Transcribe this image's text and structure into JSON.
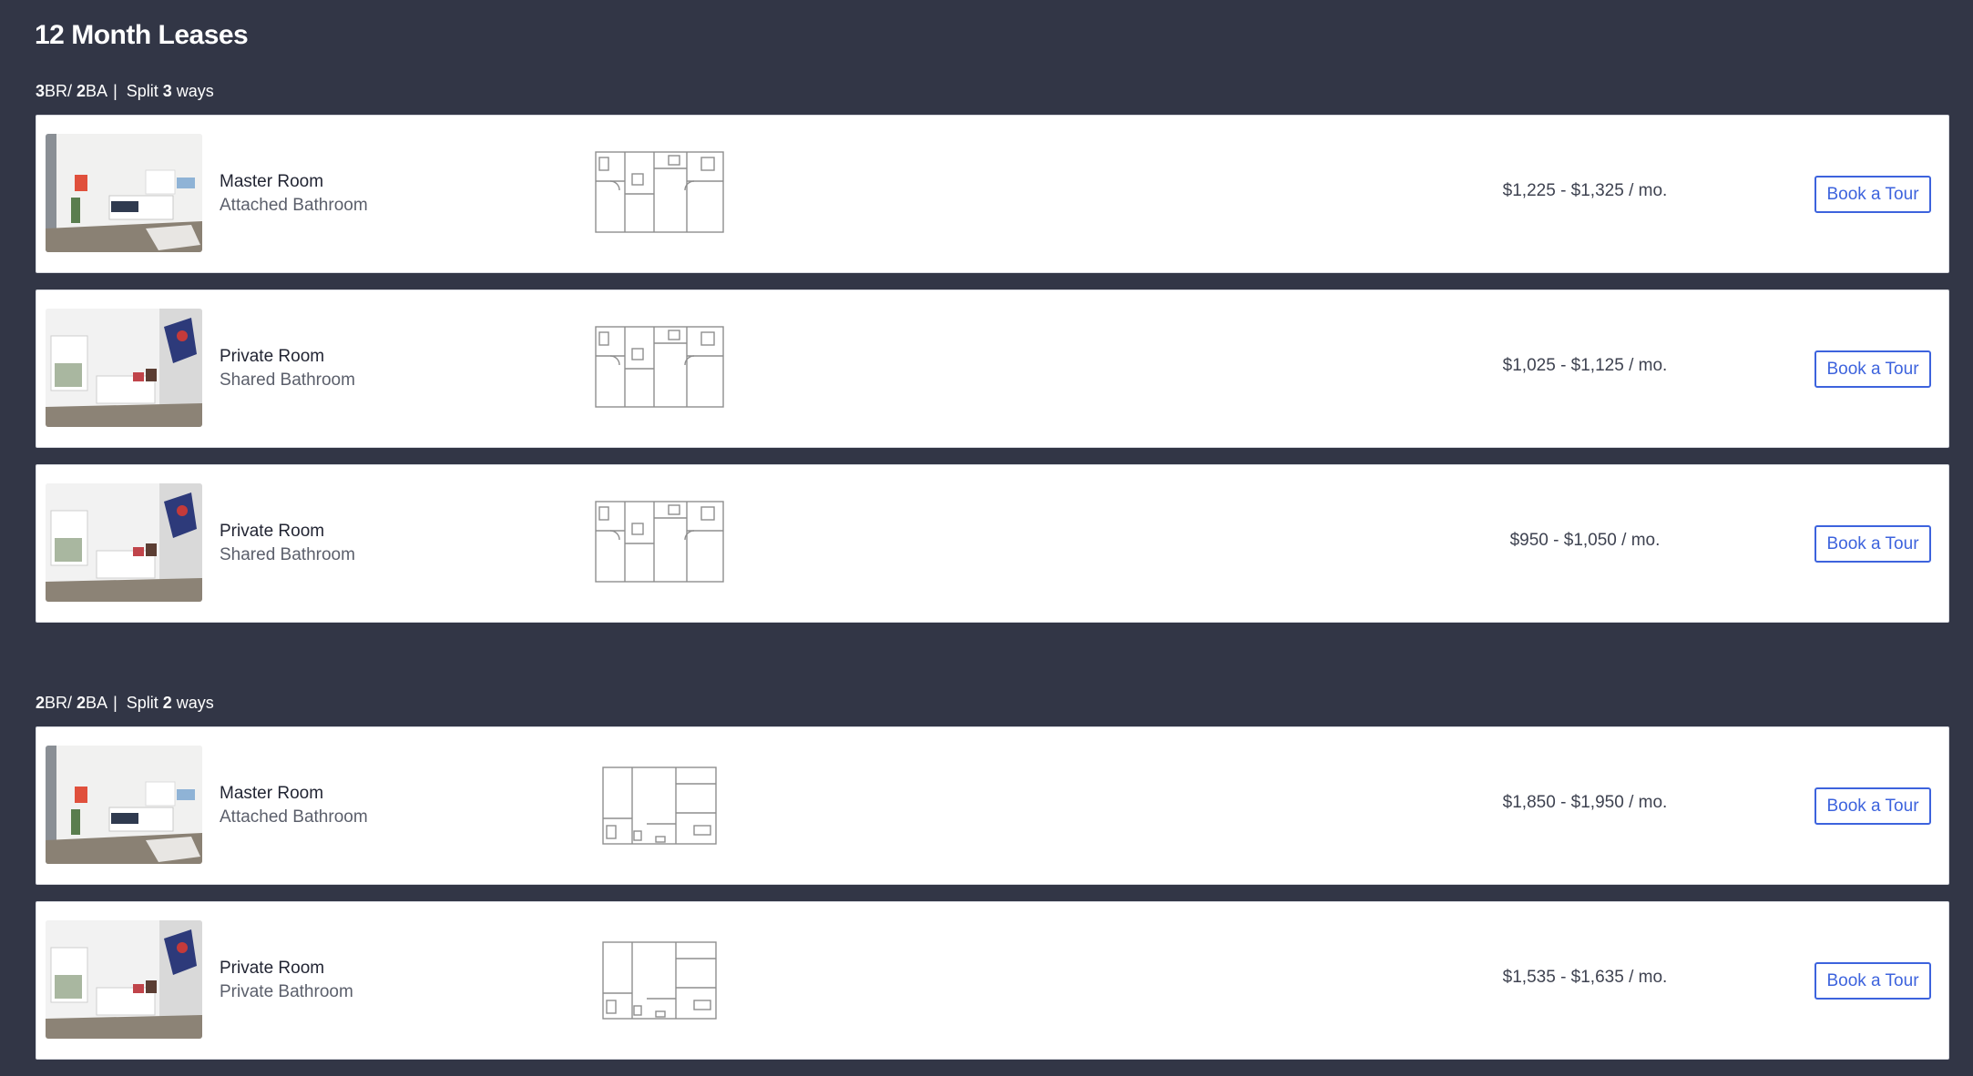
{
  "page": {
    "title": "12 Month Leases"
  },
  "colors": {
    "background": "#323646",
    "card": "#ffffff",
    "accent": "#3d63dd"
  },
  "groups": [
    {
      "beds": "3",
      "beds_suffix": "BR/ ",
      "baths": "2",
      "baths_suffix": "BA",
      "separator": "|",
      "split_prefix": "Split ",
      "split": "3",
      "split_suffix": " ways",
      "rooms": [
        {
          "image_icon": "bedroom-photo-1",
          "room_type": "Master Room",
          "bathroom": "Attached Bathroom",
          "floorplan_icon": "floorplan-3br",
          "price": "$1,225 - $1,325",
          "price_unit": " / mo.",
          "button": "Book a Tour"
        },
        {
          "image_icon": "bedroom-photo-2",
          "room_type": "Private Room",
          "bathroom": "Shared Bathroom",
          "floorplan_icon": "floorplan-3br",
          "price": "$1,025 - $1,125",
          "price_unit": " / mo.",
          "button": "Book a Tour"
        },
        {
          "image_icon": "bedroom-photo-2",
          "room_type": "Private Room",
          "bathroom": "Shared Bathroom",
          "floorplan_icon": "floorplan-3br",
          "price": "$950 - $1,050",
          "price_unit": " / mo.",
          "button": "Book a Tour"
        }
      ]
    },
    {
      "beds": "2",
      "beds_suffix": "BR/ ",
      "baths": "2",
      "baths_suffix": "BA",
      "separator": "|",
      "split_prefix": "Split ",
      "split": "2",
      "split_suffix": " ways",
      "rooms": [
        {
          "image_icon": "bedroom-photo-1",
          "room_type": "Master Room",
          "bathroom": "Attached Bathroom",
          "floorplan_icon": "floorplan-2br",
          "price": "$1,850 - $1,950",
          "price_unit": " / mo.",
          "button": "Book a Tour"
        },
        {
          "image_icon": "bedroom-photo-2",
          "room_type": "Private Room",
          "bathroom": "Private Bathroom",
          "floorplan_icon": "floorplan-2br",
          "price": "$1,535 - $1,635",
          "price_unit": " / mo.",
          "button": "Book a Tour"
        }
      ]
    }
  ]
}
